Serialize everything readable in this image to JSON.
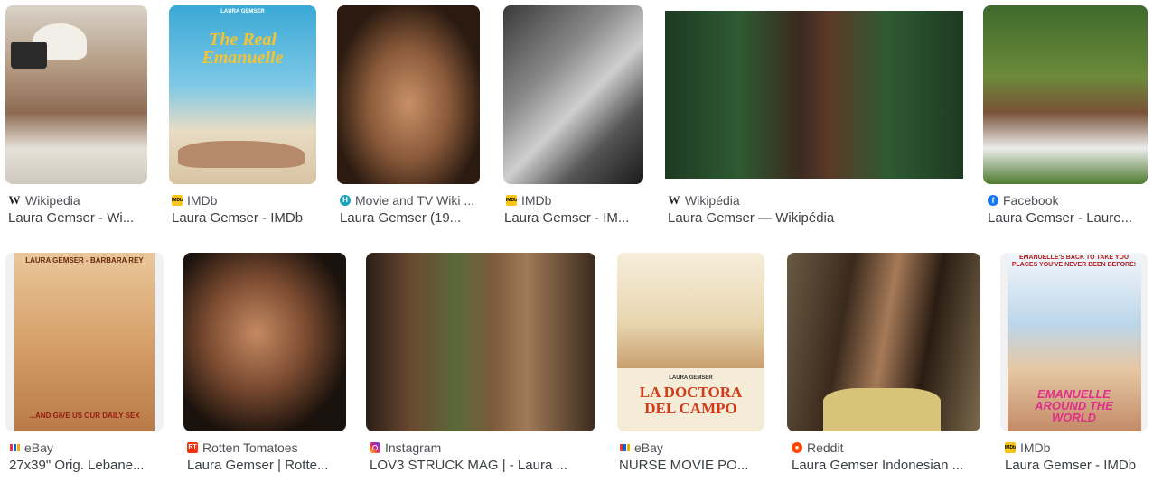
{
  "results": [
    {
      "source": "Wikipedia",
      "title": "Laura Gemser - Wi...",
      "icon": "wikipedia-icon"
    },
    {
      "source": "IMDb",
      "title": "Laura Gemser - IMDb",
      "icon": "imdb-icon",
      "poster_text": "The Real Emanuelle",
      "poster_top": "LAURA GEMSER"
    },
    {
      "source": "Movie and TV Wiki ...",
      "title": "Laura Gemser (19...",
      "icon": "movie-tv-wiki-icon"
    },
    {
      "source": "IMDb",
      "title": "Laura Gemser - IM...",
      "icon": "imdb-icon"
    },
    {
      "source": "Wikipédia",
      "title": "Laura Gemser — Wikipédia",
      "icon": "wikipedia-icon"
    },
    {
      "source": "Facebook",
      "title": "Laura Gemser - Laure...",
      "icon": "facebook-icon"
    },
    {
      "source": "eBay",
      "title": "27x39\" Orig. Lebane...",
      "icon": "ebay-icon",
      "poster_top": "LAURA GEMSER - BARBARA REY",
      "poster_bottom": "...AND GIVE US OUR DAILY SEX"
    },
    {
      "source": "Rotten Tomatoes",
      "title": "Laura Gemser | Rotte...",
      "icon": "rotten-tomatoes-icon"
    },
    {
      "source": "Instagram",
      "title": "LOV3 STRUCK MAG | - Laura ...",
      "icon": "instagram-icon"
    },
    {
      "source": "eBay",
      "title": "NURSE MOVIE PO...",
      "icon": "ebay-icon",
      "poster_top": "LAURA GEMSER",
      "poster_text": "LA DOCTORA DEL CAMPO"
    },
    {
      "source": "Reddit",
      "title": "Laura Gemser Indonesian ...",
      "icon": "reddit-icon"
    },
    {
      "source": "IMDb",
      "title": "Laura Gemser - IMDb",
      "icon": "imdb-icon",
      "poster_top": "EMANUELLE'S BACK TO TAKE YOU PLACES YOU'VE NEVER BEEN BEFORE!",
      "poster_text": "EMANUELLE AROUND THE WORLD"
    }
  ],
  "favicon_glyphs": {
    "wikipedia": "W",
    "imdb": "IMDb",
    "movie_tv_wiki": "H",
    "facebook": "f",
    "rotten_tomatoes": "RT",
    "reddit": "●"
  },
  "colors": {
    "ebay": [
      "#e53238",
      "#0064d2",
      "#f5af02",
      "#86b817"
    ]
  }
}
